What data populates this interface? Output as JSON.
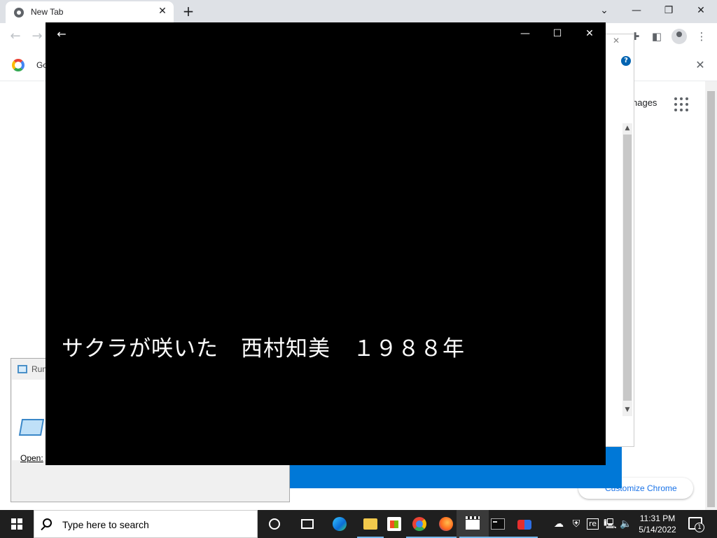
{
  "browser": {
    "tab_title": "New Tab",
    "bookmark_label": "Go",
    "images_link": "nages",
    "customize_button": "Customize Chrome"
  },
  "run_dialog": {
    "title": "Run",
    "open_label": "Open:"
  },
  "player": {
    "subtitle": "サクラが咲いた　西村知美　１９８８年"
  },
  "taskbar": {
    "search_placeholder": "Type here to search",
    "clock_time": "11:31 PM",
    "clock_date": "5/14/2022",
    "notification_count": "1",
    "tray_re_label": "re"
  },
  "colors": {
    "player_bg": "#000000",
    "blue_window": "#0078d7",
    "taskbar_bg": "#1f1f1f",
    "chrome_accent": "#1a73e8"
  }
}
